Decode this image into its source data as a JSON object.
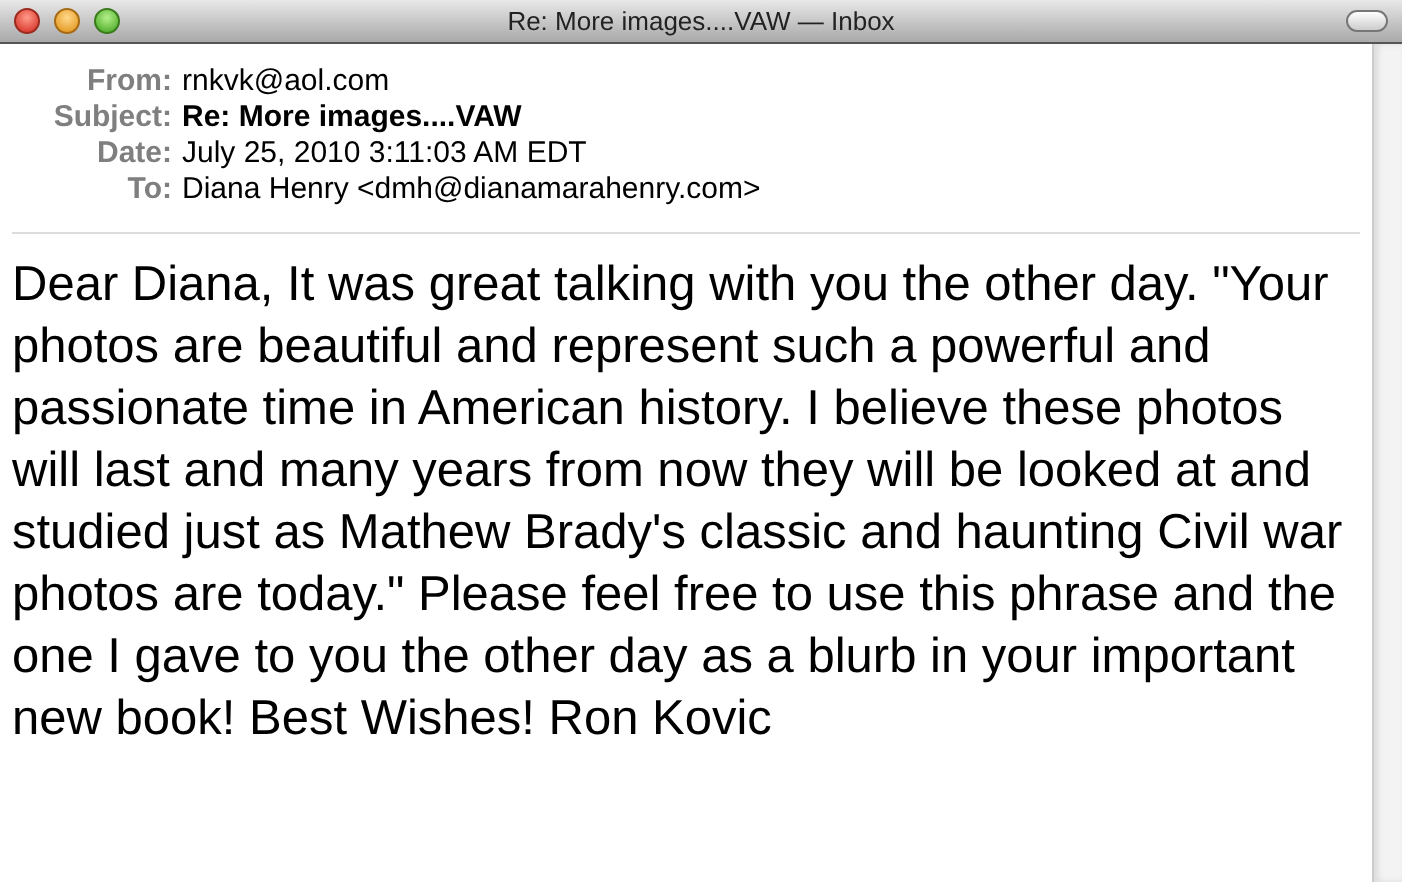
{
  "window": {
    "title": "Re: More images....VAW — Inbox"
  },
  "headers": [
    {
      "label": "From:",
      "value": "rnkvk@aol.com",
      "bold": false
    },
    {
      "label": "Subject:",
      "value": "Re: More images....VAW",
      "bold": true
    },
    {
      "label": "Date:",
      "value": "July 25, 2010 3:11:03 AM EDT",
      "bold": false
    },
    {
      "label": "To:",
      "value": "Diana Henry <dmh@dianamarahenry.com>",
      "bold": false
    }
  ],
  "body": "Dear Diana, It was great talking with you the other day. \"Your photos are beautiful and represent such a powerful and passionate time in American history. I believe these photos will last and many years from now they will be looked at and studied just as Mathew Brady's classic and haunting Civil war photos are today.\" Please feel free to use this phrase and the one I gave to you the other day as a blurb in your important new book! Best Wishes! Ron Kovic"
}
